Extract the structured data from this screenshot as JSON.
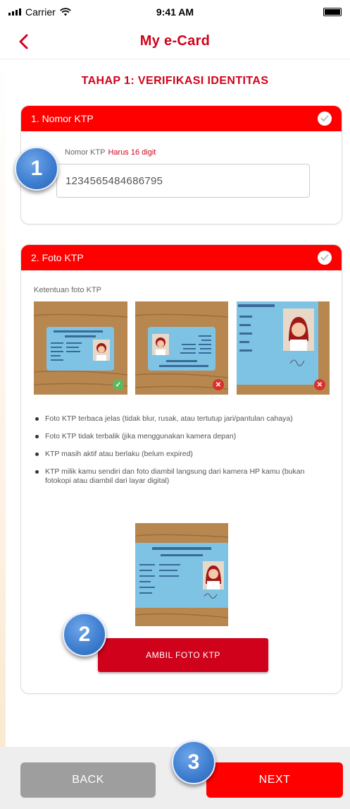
{
  "status_bar": {
    "carrier": "Carrier",
    "time": "9:41 AM",
    "signal_icon": "signal-bars-icon",
    "wifi_icon": "wifi-icon",
    "battery_icon": "battery-icon"
  },
  "nav": {
    "title": "My e-Card",
    "back_icon": "chevron-left-icon"
  },
  "step_title": "TAHAP 1: VERIFIKASI IDENTITAS",
  "section_ktp_number": {
    "header": "1. Nomor KTP",
    "completed": true,
    "field_label": "Nomor KTP",
    "field_hint": "Harus 16 digit",
    "field_value": "1234565484686795"
  },
  "section_ktp_photo": {
    "header": "2. Foto KTP",
    "completed": true,
    "rules_title": "Ketentuan foto KTP",
    "example_photos": [
      {
        "status": "valid",
        "status_icon": "check-circle-icon"
      },
      {
        "status": "invalid",
        "status_icon": "x-circle-icon"
      },
      {
        "status": "invalid",
        "status_icon": "x-circle-icon"
      }
    ],
    "rules": [
      "Foto KTP terbaca jelas (tidak blur, rusak, atau tertutup jari/pantulan cahaya)",
      "Foto KTP tidak terbalik (jika menggunakan kamera depan)",
      "KTP masih aktif atau berlaku (belum expired)",
      "KTP milik kamu sendiri dan foto diambil langsung dari kamera HP kamu (bukan fotokopi atau diambil dari layar digital)"
    ],
    "capture_button": "AMBIL FOTO KTP"
  },
  "badges": [
    "1",
    "2",
    "3"
  ],
  "footer": {
    "back_button": "BACK",
    "next_button": "NEXT"
  },
  "colors": {
    "brand_red": "#ff0000",
    "title_red": "#d0021b",
    "badge_blue": "#3f7fd1",
    "back_gray": "#9e9e9e"
  }
}
